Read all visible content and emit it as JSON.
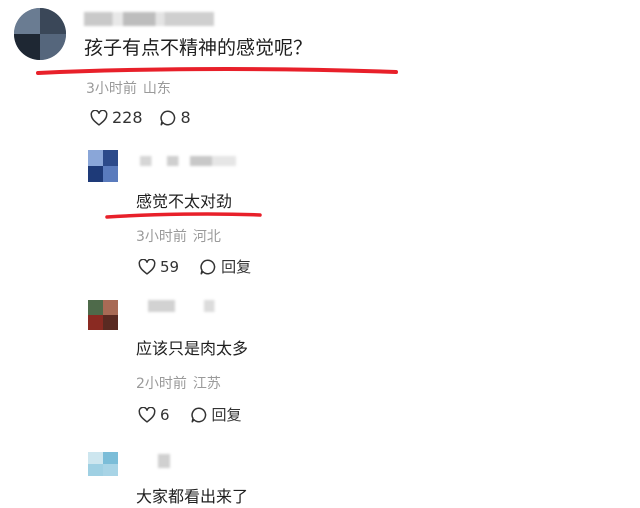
{
  "comments": [
    {
      "text": "孩子有点不精神的感觉呢？",
      "time": "3小时前",
      "location": "山东",
      "likes": "228",
      "replies": "8",
      "avatar_colors": [
        "#3c4a5c",
        "#5d6c80",
        "#1b2430"
      ]
    },
    {
      "text": "感觉不太对劲",
      "time": "3小时前",
      "location": "河北",
      "likes": "59",
      "reply_label": "回复",
      "avatar_colors": [
        "#6f8fcf",
        "#2c4a8a",
        "#8aa6d8"
      ]
    },
    {
      "text": "应该只是肉太多",
      "time": "2小时前",
      "location": "江苏",
      "likes": "6",
      "reply_label": "回复",
      "avatar_colors": [
        "#7a3b2e",
        "#a86a55",
        "#3d5a3a"
      ]
    },
    {
      "text": "大家都看出来了",
      "avatar_colors": [
        "#a8d4e6",
        "#7bbdd8",
        "#cde6ef"
      ]
    }
  ],
  "annotation_color": "#e8202a"
}
